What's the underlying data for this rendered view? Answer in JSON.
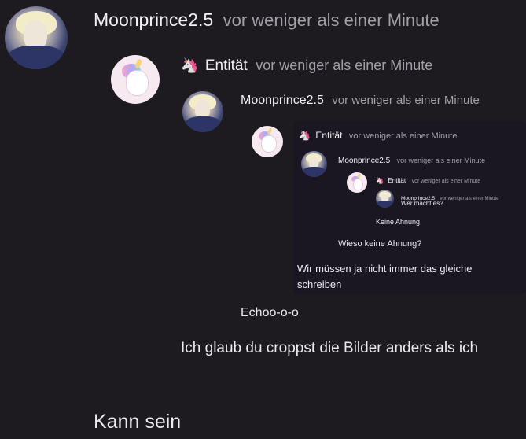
{
  "thread": {
    "level1": {
      "author": "Moonprince2.5",
      "time": "vor weniger als einer Minute",
      "avatar": "moonprince-avatar"
    },
    "level2": {
      "emoji": "🦄",
      "author": "Entität",
      "time": "vor weniger als einer Minute",
      "avatar": "unicorn-avatar"
    },
    "level3": {
      "author": "Moonprince2.5",
      "time": "vor weniger als einer Minute"
    },
    "level4": {
      "emoji": "🦄",
      "author": "Entität",
      "time": "vor weniger als einer Minute"
    },
    "level5": {
      "author": "Moonprince2.5",
      "time": "vor weniger als einer Minute"
    },
    "level6": {
      "emoji": "🦄",
      "author": "Entität",
      "time": "vor weniger als einer Minute"
    },
    "level7": {
      "author": "Moonprince2.5",
      "time": "vor weniger als einer Minute",
      "message": "Wer macht es?"
    }
  },
  "messages": {
    "m_keine_ahnung": "Keine Ahnung",
    "m_wieso": "Wieso keine Ahnung?",
    "m_wir_muessen": "Wir müssen ja nicht immer das gleiche schreiben",
    "m_echo": "Echoo-o-o",
    "m_croppst": "Ich glaub du croppst die Bilder anders als ich",
    "m_kann_sein": "Kann sein"
  },
  "colors": {
    "background": "#1d1a20",
    "text": "#eceaf0",
    "muted": "#a29fa8"
  }
}
